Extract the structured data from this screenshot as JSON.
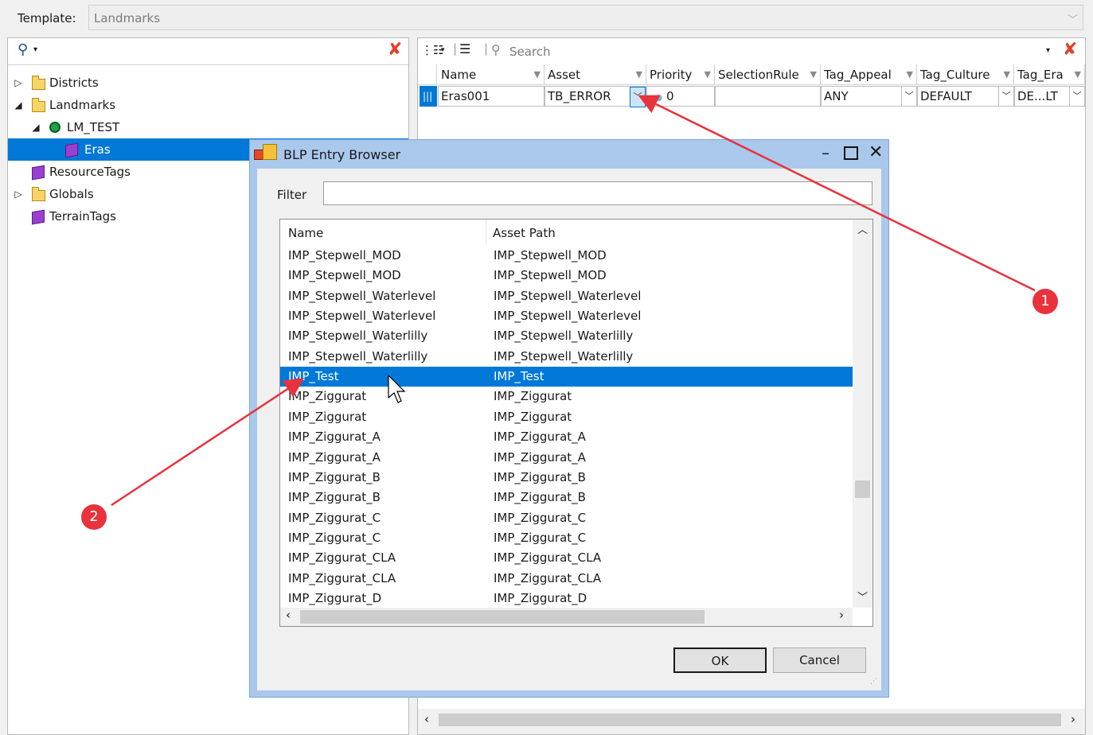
{
  "template": {
    "label": "Template:",
    "value": "Landmarks"
  },
  "tree": {
    "nodes": [
      {
        "label": "Districts",
        "expander": "▷",
        "icon": "folder-icon"
      },
      {
        "label": "Landmarks",
        "expander": "◢",
        "icon": "folder-icon"
      },
      {
        "label": "LM_TEST",
        "expander": "◢",
        "icon": "green-node-icon"
      },
      {
        "label": "Eras",
        "expander": "",
        "icon": "purple-cube-icon",
        "selected": true
      },
      {
        "label": "ResourceTags",
        "expander": "",
        "icon": "purple-cube-icon"
      },
      {
        "label": "Globals",
        "expander": "▷",
        "icon": "folder-icon"
      },
      {
        "label": "TerrainTags",
        "expander": "",
        "icon": "purple-cube-icon"
      }
    ]
  },
  "grid": {
    "search_placeholder": "Search",
    "columns": [
      "Name",
      "Asset",
      "Priority",
      "SelectionRule",
      "Tag_Appeal",
      "Tag_Culture",
      "Tag_Era"
    ],
    "row": {
      "name": "Eras001",
      "asset": "TB_ERROR",
      "priority": "0",
      "selection_rule": "",
      "tag_appeal": "ANY",
      "tag_culture": "DEFAULT",
      "tag_era": "DE...LT"
    }
  },
  "dialog": {
    "title": "BLP Entry Browser",
    "filter_label": "Filter",
    "filter_value": "",
    "columns": [
      "Name",
      "Asset Path"
    ],
    "rows": [
      {
        "name": "IMP_Stepwell_MOD",
        "path": "IMP_Stepwell_MOD"
      },
      {
        "name": "IMP_Stepwell_MOD",
        "path": "IMP_Stepwell_MOD"
      },
      {
        "name": "IMP_Stepwell_Waterlevel",
        "path": "IMP_Stepwell_Waterlevel"
      },
      {
        "name": "IMP_Stepwell_Waterlevel",
        "path": "IMP_Stepwell_Waterlevel"
      },
      {
        "name": "IMP_Stepwell_Waterlilly",
        "path": "IMP_Stepwell_Waterlilly"
      },
      {
        "name": "IMP_Stepwell_Waterlilly",
        "path": "IMP_Stepwell_Waterlilly"
      },
      {
        "name": "IMP_Test",
        "path": "IMP_Test",
        "selected": true
      },
      {
        "name": "IMP_Ziggurat",
        "path": "IMP_Ziggurat"
      },
      {
        "name": "IMP_Ziggurat",
        "path": "IMP_Ziggurat"
      },
      {
        "name": "IMP_Ziggurat_A",
        "path": "IMP_Ziggurat_A"
      },
      {
        "name": "IMP_Ziggurat_A",
        "path": "IMP_Ziggurat_A"
      },
      {
        "name": "IMP_Ziggurat_B",
        "path": "IMP_Ziggurat_B"
      },
      {
        "name": "IMP_Ziggurat_B",
        "path": "IMP_Ziggurat_B"
      },
      {
        "name": "IMP_Ziggurat_C",
        "path": "IMP_Ziggurat_C"
      },
      {
        "name": "IMP_Ziggurat_C",
        "path": "IMP_Ziggurat_C"
      },
      {
        "name": "IMP_Ziggurat_CLA",
        "path": "IMP_Ziggurat_CLA"
      },
      {
        "name": "IMP_Ziggurat_CLA",
        "path": "IMP_Ziggurat_CLA"
      },
      {
        "name": "IMP_Ziggurat_D",
        "path": "IMP_Ziggurat_D"
      }
    ],
    "ok_label": "OK",
    "cancel_label": "Cancel"
  },
  "annotations": {
    "badge_1": "1",
    "badge_2": "2",
    "color": "#e8323c"
  },
  "colors": {
    "selection": "#0078d7",
    "dialog_frame": "#a9c8ec"
  }
}
